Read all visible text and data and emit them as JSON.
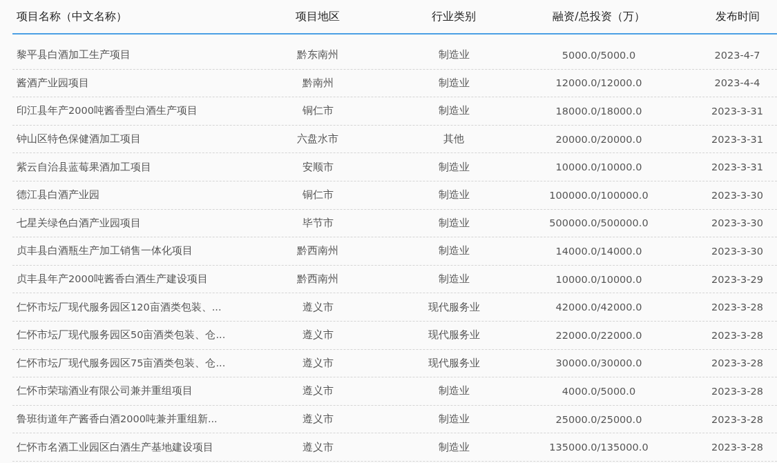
{
  "table": {
    "columns": [
      "项目名称（中文名称）",
      "项目地区",
      "行业类别",
      "融资/总投资（万）",
      "发布时间"
    ],
    "rows": [
      [
        "黎平县白酒加工生产项目",
        "黔东南州",
        "制造业",
        "5000.0/5000.0",
        "2023-4-7"
      ],
      [
        "酱酒产业园项目",
        "黔南州",
        "制造业",
        "12000.0/12000.0",
        "2023-4-4"
      ],
      [
        "印江县年产2000吨酱香型白酒生产项目",
        "铜仁市",
        "制造业",
        "18000.0/18000.0",
        "2023-3-31"
      ],
      [
        "钟山区特色保健酒加工项目",
        "六盘水市",
        "其他",
        "20000.0/20000.0",
        "2023-3-31"
      ],
      [
        "紫云自治县蓝莓果酒加工项目",
        "安顺市",
        "制造业",
        "10000.0/10000.0",
        "2023-3-31"
      ],
      [
        "德江县白酒产业园",
        "铜仁市",
        "制造业",
        "100000.0/100000.0",
        "2023-3-30"
      ],
      [
        "七星关绿色白酒产业园项目",
        "毕节市",
        "制造业",
        "500000.0/500000.0",
        "2023-3-30"
      ],
      [
        "贞丰县白酒瓶生产加工销售一体化项目",
        "黔西南州",
        "制造业",
        "14000.0/14000.0",
        "2023-3-30"
      ],
      [
        "贞丰县年产2000吨酱香白酒生产建设项目",
        "黔西南州",
        "制造业",
        "10000.0/10000.0",
        "2023-3-29"
      ],
      [
        "仁怀市坛厂现代服务园区120亩酒类包装、...",
        "遵义市",
        "现代服务业",
        "42000.0/42000.0",
        "2023-3-28"
      ],
      [
        "仁怀市坛厂现代服务园区50亩酒类包装、仓...",
        "遵义市",
        "现代服务业",
        "22000.0/22000.0",
        "2023-3-28"
      ],
      [
        "仁怀市坛厂现代服务园区75亩酒类包装、仓...",
        "遵义市",
        "现代服务业",
        "30000.0/30000.0",
        "2023-3-28"
      ],
      [
        "仁怀市荣瑞酒业有限公司兼并重组项目",
        "遵义市",
        "制造业",
        "4000.0/5000.0",
        "2023-3-28"
      ],
      [
        "鲁班街道年产酱香白酒2000吨兼并重组新...",
        "遵义市",
        "制造业",
        "25000.0/25000.0",
        "2023-3-28"
      ],
      [
        "仁怀市名酒工业园区白酒生产基地建设项目",
        "遵义市",
        "制造业",
        "135000.0/135000.0",
        "2023-3-28"
      ]
    ]
  }
}
